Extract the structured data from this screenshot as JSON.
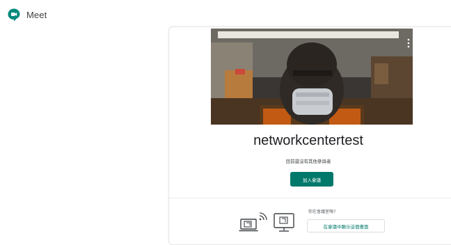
{
  "header": {
    "app_name": "Meet",
    "logo_icon": "meet-logo-icon",
    "brand_color": "#00897b"
  },
  "preview": {
    "description_icon": "camera-preview",
    "more_icon": "more-vert-icon"
  },
  "meeting": {
    "name": "networkcentertest",
    "status": "目前還沒有其他參與者",
    "join_label": "加入會議"
  },
  "cast": {
    "prompt": "你在會議室嗎?",
    "present_label": "在會議中顯示這個畫面",
    "cast_icon": "cast-to-room-icon",
    "room_icon": "meeting-room-display-icon"
  },
  "colors": {
    "accent": "#00796b",
    "border": "#e6e6e6"
  }
}
